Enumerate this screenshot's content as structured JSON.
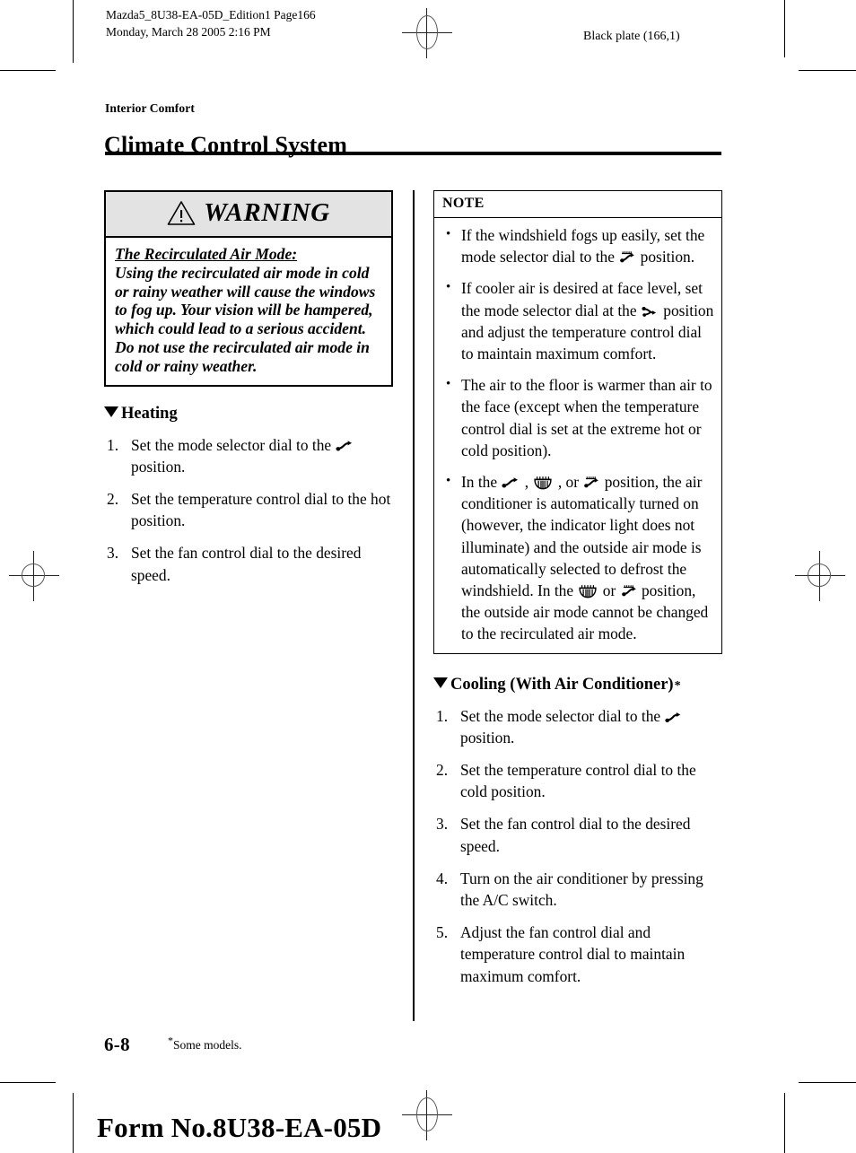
{
  "header": {
    "job_line1": "Mazda5_8U38-EA-05D_Edition1 Page166",
    "job_line2": "Monday, March 28 2005 2:16 PM",
    "plate": "Black plate (166,1)"
  },
  "title": {
    "eyebrow": "Interior Comfort",
    "heading": "Climate Control System"
  },
  "warning": {
    "label": "WARNING",
    "lead": "The Recirculated Air Mode:",
    "body": "Using the recirculated air mode in cold or rainy weather will cause the windows to fog up. Your vision will be hampered, which could lead to a serious accident. Do not use the recirculated air mode in cold or rainy weather."
  },
  "heating": {
    "heading": "Heating",
    "steps": [
      {
        "before": "Set the mode selector dial to the ",
        "symbol": "foot-mode-icon",
        "after": " position."
      },
      {
        "before": "Set the temperature control dial to the hot position.",
        "symbol": "",
        "after": ""
      },
      {
        "before": "Set the fan control dial to the desired speed.",
        "symbol": "",
        "after": ""
      }
    ]
  },
  "note": {
    "label": "NOTE",
    "items": [
      {
        "parts": [
          {
            "type": "text",
            "value": "If the windshield fogs up easily, set the mode selector dial to the "
          },
          {
            "type": "symbol",
            "value": "defrost-mode-icon"
          },
          {
            "type": "text",
            "value": " position."
          }
        ]
      },
      {
        "parts": [
          {
            "type": "text",
            "value": "If cooler air is desired at face level, set the mode selector dial at the "
          },
          {
            "type": "symbol",
            "value": "face-foot-mode-icon"
          },
          {
            "type": "text",
            "value": " position and adjust the temperature control dial to maintain maximum comfort."
          }
        ]
      },
      {
        "parts": [
          {
            "type": "text",
            "value": "The air to the floor is warmer than air to the face (except when the temperature control dial is set at the extreme hot or cold position)."
          }
        ]
      },
      {
        "parts": [
          {
            "type": "text",
            "value": "In the "
          },
          {
            "type": "symbol",
            "value": "foot-mode-icon"
          },
          {
            "type": "text",
            "value": " , "
          },
          {
            "type": "symbol",
            "value": "windshield-defrost-icon"
          },
          {
            "type": "text",
            "value": " , or "
          },
          {
            "type": "symbol",
            "value": "defrost-mode-icon"
          },
          {
            "type": "text",
            "value": "  position, the air conditioner is automatically turned on (however, the indicator light does not illuminate) and the outside air mode is automatically selected to defrost the windshield. In the "
          },
          {
            "type": "symbol",
            "value": "windshield-defrost-icon"
          },
          {
            "type": "text",
            "value": "  or "
          },
          {
            "type": "symbol",
            "value": "defrost-mode-icon"
          },
          {
            "type": "text",
            "value": "  position, the outside air mode cannot be changed to the recirculated air mode."
          }
        ]
      }
    ]
  },
  "cooling": {
    "heading": "Cooling (With Air Conditioner)",
    "heading_marker": "*",
    "steps": [
      {
        "before": "Set the mode selector dial to the ",
        "symbol": "face-mode-icon",
        "after": " position."
      },
      {
        "before": "Set the temperature control dial to the cold position.",
        "symbol": "",
        "after": ""
      },
      {
        "before": "Set the fan control dial to the desired speed.",
        "symbol": "",
        "after": ""
      },
      {
        "before": "Turn on the air conditioner by pressing the A/C switch.",
        "symbol": "",
        "after": ""
      },
      {
        "before": "Adjust the fan control dial and temperature control dial to maintain maximum comfort.",
        "symbol": "",
        "after": ""
      }
    ]
  },
  "footer": {
    "page_number": "6-8",
    "footnote_marker": "*",
    "footnote": "Some models.",
    "form_number": "Form No.8U38-EA-05D"
  },
  "colors": {
    "ink": "#000000",
    "warning_header_fill": "#e3e3e3",
    "paper": "#ffffff"
  }
}
